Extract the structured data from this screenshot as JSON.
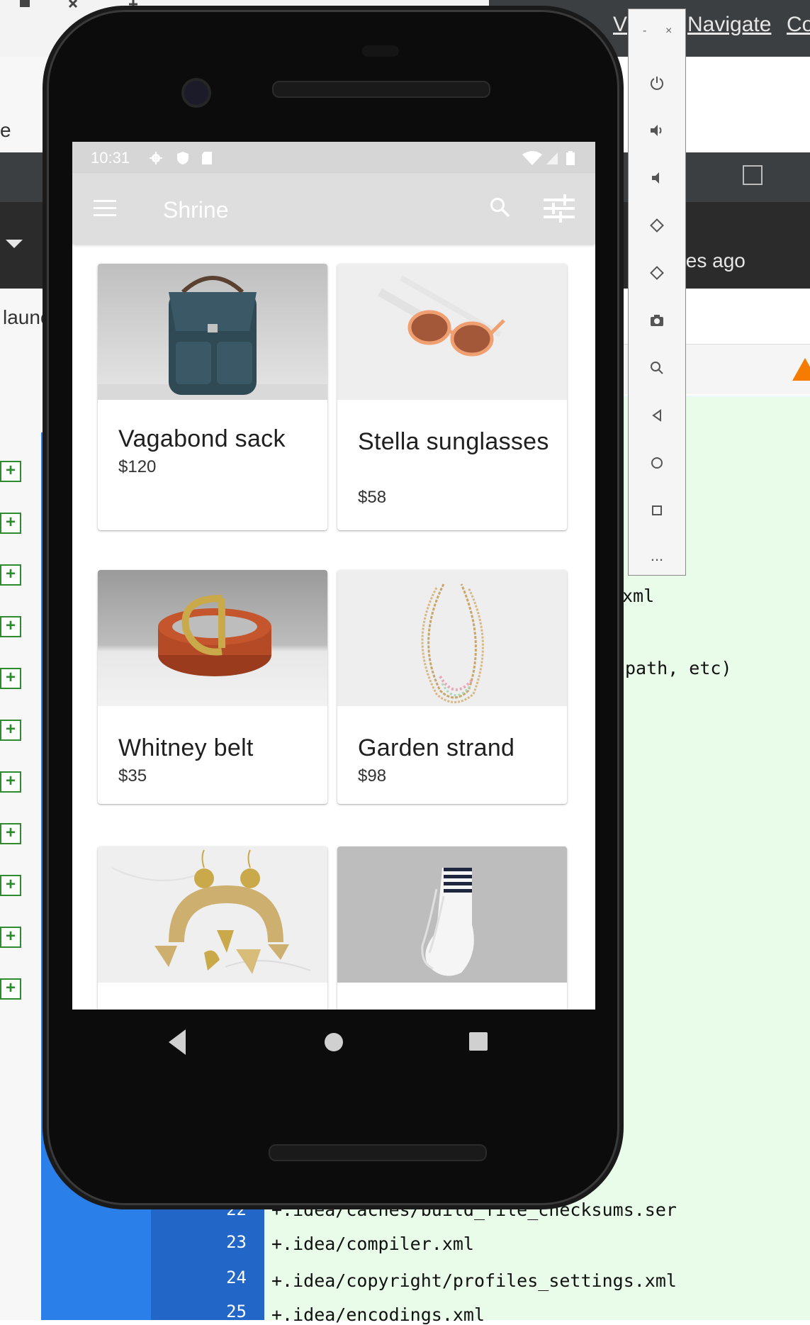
{
  "background_ide": {
    "menu_items": [
      "V",
      "Navigate",
      "Co"
    ],
    "left_fragment_e": "e",
    "ago_text": "tes ago",
    "launch_fragment": "launc",
    "code_fragments": [
      "xml",
      "path, etc)"
    ],
    "code_lines": [
      {
        "num": "22",
        "text": "+.idea/caches/build_file_checksums.ser"
      },
      {
        "num": "23",
        "text": "+.idea/compiler.xml"
      },
      {
        "num": "24",
        "text": "+.idea/copyright/profiles_settings.xml"
      },
      {
        "num": "25",
        "text": "+.idea/encodings.xml"
      }
    ],
    "plus_glyph": "+"
  },
  "emulator_toolbar": {
    "minimize": "-",
    "close": "×",
    "buttons": [
      "power-icon",
      "volume-up-icon",
      "volume-down-icon",
      "rotate-left-icon",
      "rotate-right-icon",
      "camera-icon",
      "zoom-icon",
      "back-icon",
      "home-icon",
      "overview-icon",
      "more-icon"
    ],
    "more_label": "..."
  },
  "statusbar": {
    "time": "10:31"
  },
  "app": {
    "title": "Shrine",
    "accent": "#dedede"
  },
  "products": [
    {
      "name": "Vagabond sack",
      "price": "$120",
      "image": "backpack"
    },
    {
      "name": "Stella sunglasses",
      "price": "$58",
      "image": "sunglasses"
    },
    {
      "name": "Whitney belt",
      "price": "$35",
      "image": "belt"
    },
    {
      "name": "Garden strand",
      "price": "$98",
      "image": "necklace"
    },
    {
      "name": "",
      "price": "",
      "image": "earrings"
    },
    {
      "name": "",
      "price": "",
      "image": "socks"
    }
  ]
}
